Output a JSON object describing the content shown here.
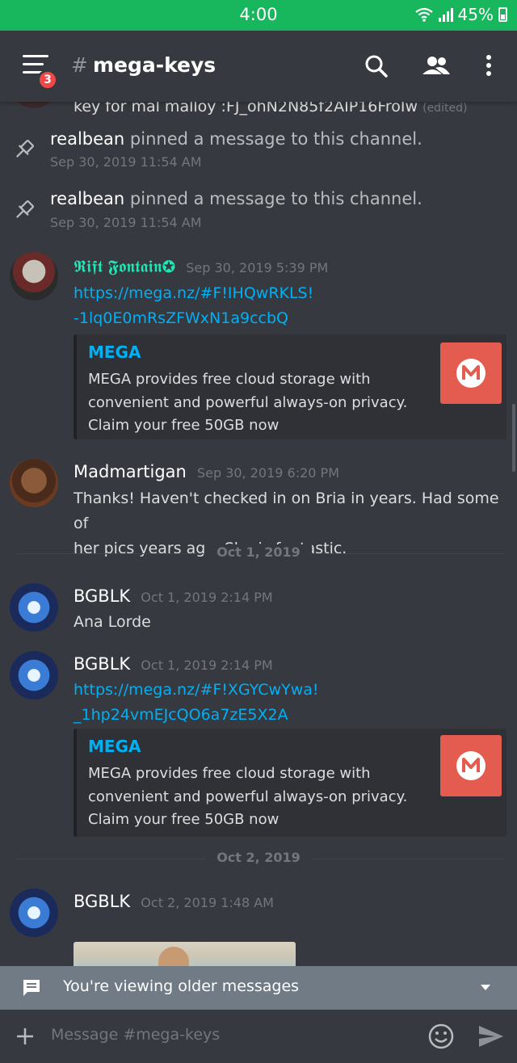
{
  "status_bar": {
    "time": "4:00",
    "battery": "45%"
  },
  "header": {
    "hash": "#",
    "channel": "mega-keys",
    "badge_count": "3"
  },
  "messages": {
    "cut_line": {
      "text": "key for mal malloy :FJ_ohN2N85f2AIP16FroIw",
      "edited": "(edited)"
    },
    "pin1": {
      "user": "realbean",
      "text": "pinned a message to this channel.",
      "time": "Sep 30, 2019 11:54 AM"
    },
    "pin2": {
      "user": "realbean",
      "text": "pinned a message to this channel.",
      "time": "Sep 30, 2019 11:54 AM"
    },
    "msg_rift": {
      "user": "𝕽𝖎𝖋𝖙 𝕱𝖔𝖓𝖙𝖆𝖎𝖓✪",
      "time": "Sep 30, 2019 5:39 PM",
      "link_line1": "https://mega.nz/#F!IHQwRKLS!",
      "link_line2": "-1lq0E0mRsZFWxN1a9ccbQ",
      "embed": {
        "title": "MEGA",
        "desc1": "MEGA provides free cloud storage with",
        "desc2": "convenient and powerful always-on privacy.",
        "desc3": "Claim your free 50GB now"
      }
    },
    "msg_mad": {
      "user": "Madmartigan",
      "time": "Sep 30, 2019 6:20 PM",
      "line1": "Thanks! Haven't checked in on Bria in years. Had some of",
      "line2": "her pics years ago. She is fantastic."
    },
    "divider1": "Oct 1, 2019",
    "msg_bg1": {
      "user": "BGBLK",
      "time": "Oct 1, 2019 2:14 PM",
      "text": "Ana Lorde"
    },
    "msg_bg2": {
      "user": "BGBLK",
      "time": "Oct 1, 2019 2:14 PM",
      "link_line1": "https://mega.nz/#F!XGYCwYwa!",
      "link_line2": "_1hp24vmEJcQO6a7zE5X2A",
      "embed": {
        "title": "MEGA",
        "desc1": "MEGA provides free cloud storage with",
        "desc2": "convenient and powerful always-on privacy.",
        "desc3": "Claim your free 50GB now"
      }
    },
    "divider2": "Oct 2, 2019",
    "msg_bg3": {
      "user": "BGBLK",
      "time": "Oct 2, 2019 1:48 AM"
    }
  },
  "older_bar": {
    "text": "You're viewing older messages"
  },
  "composer": {
    "placeholder": "Message #mega-keys"
  },
  "colors": {
    "status_green": "#18b65d",
    "background": "#36393f",
    "link": "#00b0f4",
    "rift_name": "#1de9b6",
    "mega_red": "#e35c4f",
    "badge_red": "#f04747"
  },
  "icons": [
    "wifi-icon",
    "signal-icon",
    "battery-icon",
    "menu-icon",
    "search-icon",
    "members-icon",
    "more-vert-icon",
    "pin-icon",
    "mega-logo-icon",
    "message-icon",
    "dropdown-icon",
    "plus-icon",
    "emoji-icon",
    "send-icon"
  ]
}
